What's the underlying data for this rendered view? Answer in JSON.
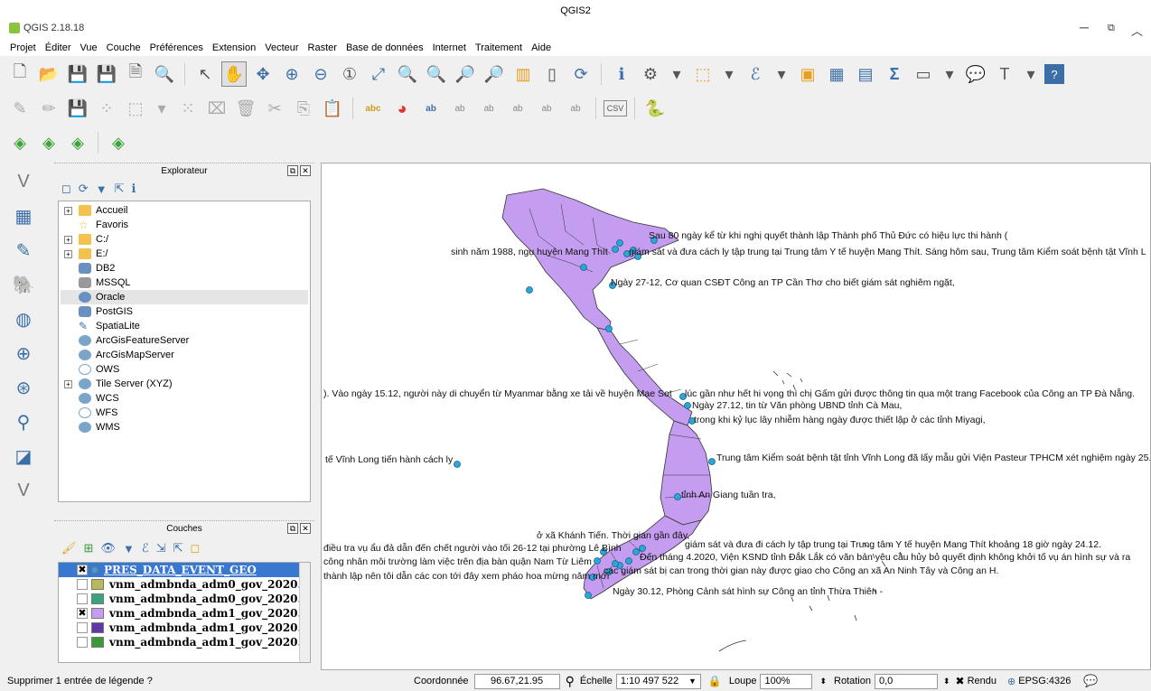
{
  "window": {
    "center_title": "QGIS2",
    "app_title": "QGIS 2.18.18"
  },
  "menu": [
    "Projet",
    "Éditer",
    "Vue",
    "Couche",
    "Préférences",
    "Extension",
    "Vecteur",
    "Raster",
    "Base de données",
    "Internet",
    "Traitement",
    "Aide"
  ],
  "explorer": {
    "title": "Explorateur",
    "items": [
      {
        "label": "Accueil",
        "icon": "folder-icon",
        "expander": "+"
      },
      {
        "label": "Favoris",
        "icon": "star-icon",
        "expander": ""
      },
      {
        "label": "C:/",
        "icon": "folder-icon",
        "expander": "+"
      },
      {
        "label": "E:/",
        "icon": "folder-icon",
        "expander": "+"
      },
      {
        "label": "DB2",
        "icon": "db2-icon",
        "expander": ""
      },
      {
        "label": "MSSQL",
        "icon": "mssql-icon",
        "expander": ""
      },
      {
        "label": "Oracle",
        "icon": "oracle-icon",
        "expander": ""
      },
      {
        "label": "PostGIS",
        "icon": "postgis-icon",
        "expander": ""
      },
      {
        "label": "SpatiaLite",
        "icon": "spatialite-icon",
        "expander": ""
      },
      {
        "label": "ArcGisFeatureServer",
        "icon": "arcgis-icon",
        "expander": ""
      },
      {
        "label": "ArcGisMapServer",
        "icon": "arcgis-icon",
        "expander": ""
      },
      {
        "label": "OWS",
        "icon": "ows-icon",
        "expander": ""
      },
      {
        "label": "Tile Server (XYZ)",
        "icon": "tile-icon",
        "expander": "+"
      },
      {
        "label": "WCS",
        "icon": "wcs-icon",
        "expander": ""
      },
      {
        "label": "WFS",
        "icon": "wfs-icon",
        "expander": ""
      },
      {
        "label": "WMS",
        "icon": "wms-icon",
        "expander": ""
      }
    ]
  },
  "layers_panel": {
    "title": "Couches",
    "layers": [
      {
        "name": "PRES_DATA_EVENT_GEO",
        "checked": "✖",
        "color": "#3a9fd6",
        "selected": true
      },
      {
        "name": "vnm_admbnda_adm0_gov_2020...",
        "checked": "",
        "color": "#b8b85a",
        "selected": false
      },
      {
        "name": "vnm_admbnda_adm0_gov_2020...",
        "checked": "",
        "color": "#3aa37d",
        "selected": false
      },
      {
        "name": "vnm_admbnda_adm1_gov_2020...",
        "checked": "✖",
        "color": "#c89cf0",
        "selected": false
      },
      {
        "name": "vnm_admbnda_adm1_gov_2020...",
        "checked": "",
        "color": "#5d3aa8",
        "selected": false
      },
      {
        "name": "vnm_admbnda_adm1_gov_2020...",
        "checked": "",
        "color": "#3a9a3a",
        "selected": false
      }
    ]
  },
  "map_labels": [
    "Sau 80 ngày kể từ khi nghị quyết thành lập Thành phố Thủ Đức có hiệu lực thi hành (",
    "sinh năm 1988, ngụ huyện Mang Thít",
    "giám sát và đưa cách ly tập trung tại Trung tâm Y tế huyện Mang Thít. Sáng hôm sau, Trung tâm Kiểm soát bệnh tật Vĩnh L",
    "Ngày 27-12, Cơ quan CSĐT Công an TP Cần Thơ cho biết giám sát nghiêm ngặt,",
    "). Vào ngày 15.12, người này di chuyển từ Myanmar bằng xe tải về huyện Mae Sot",
    "lúc gần như hết hi vọng thì chị Gấm gửi được thông tin qua một trang Facebook của Công an TP Đà Nẵng.",
    "Ngày 27.12, tin từ Văn phòng UBND tỉnh Cà Mau,",
    "trong khi kỷ lục lây nhiễm hàng ngày được thiết lập ở các tỉnh Miyagi,",
    "tế Vĩnh Long tiến hành cách ly",
    "Trung tâm Kiểm soát bệnh tật tỉnh Vĩnh Long đã lấy mẫu gửi Viện Pasteur TPHCM xét nghiệm ngày 25.1",
    "tỉnh An Giang tuần tra,",
    "ở xã Khánh Tiến. Thời gian gần đây,",
    "giám sát và đưa đi cách ly tập trung tại Trung tâm Y tế huyện Mang Thít khoảng 18 giờ ngày 24.12.",
    "điều tra vụ ẩu đả dẫn đến chết người vào tối 26-12 tại phường Lê Bình",
    "Đến tháng 4.2020, Viện KSND tỉnh Đắk Lắk có văn bản yêu cầu hủy bỏ quyết định không khởi tố vụ án hình sự và ra",
    "công nhân môi trường làm việc trên địa bàn quận Nam Từ Liêm",
    "các giám sát bị can trong thời gian này được giao cho Công an xã An Ninh Tây và Công an H.",
    "thành lập nên tôi dẫn các con tới đây xem pháo hoa mừng năm mới",
    "Ngày 30.12, Phòng Cảnh sát hình sự Công an tỉnh Thừa Thiên -"
  ],
  "status": {
    "message": "Supprimer 1 entrée de légende ?",
    "coord_label": "Coordonnée",
    "coord_value": "96.67,21.95",
    "scale_label": "Échelle",
    "scale_value": "1:10 497 522",
    "zoom_label": "Loupe",
    "zoom_value": "100%",
    "rotation_label": "Rotation",
    "rotation_value": "0,0",
    "render_label": "Rendu",
    "crs": "EPSG:4326"
  },
  "colors": {
    "province_fill": "#c49cf0",
    "province_stroke": "#333333",
    "point_fill": "#2aa7d9"
  }
}
